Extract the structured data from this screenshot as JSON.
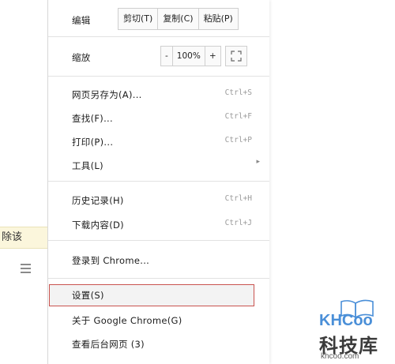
{
  "background": {
    "tab_text": "除该"
  },
  "menu": {
    "edit": {
      "label": "编辑",
      "cut": "剪切(T)",
      "copy": "复制(C)",
      "paste": "粘贴(P)"
    },
    "zoom": {
      "label": "缩放",
      "minus": "-",
      "level": "100%",
      "plus": "+"
    },
    "items": [
      {
        "label": "网页另存为(A)...",
        "shortcut": "Ctrl+S"
      },
      {
        "label": "查找(F)...",
        "shortcut": "Ctrl+F"
      },
      {
        "label": "打印(P)...",
        "shortcut": "Ctrl+P"
      },
      {
        "label": "工具(L)",
        "shortcut": ""
      },
      {
        "label": "历史记录(H)",
        "shortcut": "Ctrl+H"
      },
      {
        "label": "下载内容(D)",
        "shortcut": "Ctrl+J"
      },
      {
        "label": "登录到 Chrome...",
        "shortcut": ""
      },
      {
        "label": "设置(S)",
        "shortcut": ""
      },
      {
        "label": "关于 Google Chrome(G)",
        "shortcut": ""
      },
      {
        "label": "查看后台网页 (3)",
        "shortcut": ""
      }
    ]
  },
  "watermark": {
    "brand": "KHCoo",
    "name": "科技库",
    "url": "khcoo.com"
  },
  "colors": {
    "highlight_border": "#c9534f",
    "logo_blue": "#4a8fd8"
  }
}
